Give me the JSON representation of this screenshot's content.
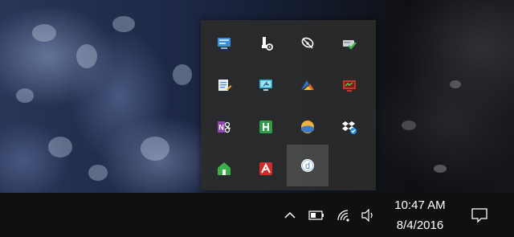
{
  "overflow_tray": {
    "icons": [
      {
        "name": "network-manager-icon",
        "color": "#3a8ee0"
      },
      {
        "name": "usb-settings-icon",
        "color": "#ffffff"
      },
      {
        "name": "satellite-dish-icon",
        "color": "#ffffff"
      },
      {
        "name": "disk-check-icon",
        "color": "#3ab04a"
      },
      {
        "name": "notepad-edit-icon",
        "color": "#4d8fd6"
      },
      {
        "name": "remote-desktop-icon",
        "color": "#2aa7c8"
      },
      {
        "name": "colorful-app-icon",
        "color": "#e06030"
      },
      {
        "name": "red-monitor-app-icon",
        "color": "#c0392b"
      },
      {
        "name": "onenote-clipper-icon",
        "color": "#8e44ad"
      },
      {
        "name": "h-app-icon",
        "color": "#2e9c48"
      },
      {
        "name": "weather-sun-icon",
        "color": "#f0b040"
      },
      {
        "name": "dropbox-sync-icon",
        "color": "#ffffff"
      },
      {
        "name": "home-app-icon",
        "color": "#3cae48"
      },
      {
        "name": "avira-antivirus-icon",
        "color": "#d32a2a"
      },
      {
        "name": "d-circle-app-icon",
        "color": "#ffffff"
      }
    ]
  },
  "taskbar": {
    "time": "10:47 AM",
    "date": "8/4/2016"
  }
}
